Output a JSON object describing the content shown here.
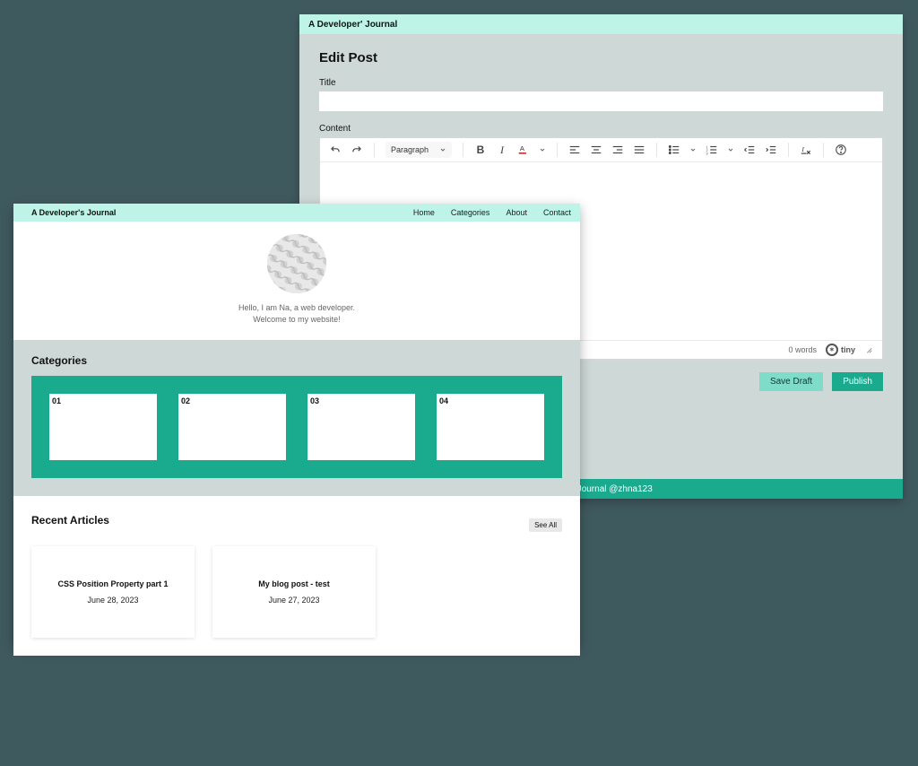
{
  "edit": {
    "titlebar": "A Developer' Journal",
    "heading": "Edit Post",
    "title_label": "Title",
    "title_value": "",
    "content_label": "Content",
    "para_select": "Paragraph",
    "word_count": "0 words",
    "tiny_brand": "tiny",
    "save_draft": "Save Draft",
    "publish": "Publish",
    "footer": "'s Journal @zhna123"
  },
  "blog": {
    "brand": "A Developer's Journal",
    "nav": {
      "home": "Home",
      "categories": "Categories",
      "about": "About",
      "contact": "Contact"
    },
    "hero_line1": "Hello, I am Na, a web developer.",
    "hero_line2": "Welcome to my website!",
    "categories_heading": "Categories",
    "cats": {
      "c1": "01",
      "c2": "02",
      "c3": "03",
      "c4": "04"
    },
    "recent_heading": "Recent Articles",
    "see_all": "See All",
    "articles": {
      "a1": {
        "title": "CSS Position Property part 1",
        "date": "June 28, 2023"
      },
      "a2": {
        "title": "My blog post - test",
        "date": "June 27, 2023"
      }
    }
  }
}
